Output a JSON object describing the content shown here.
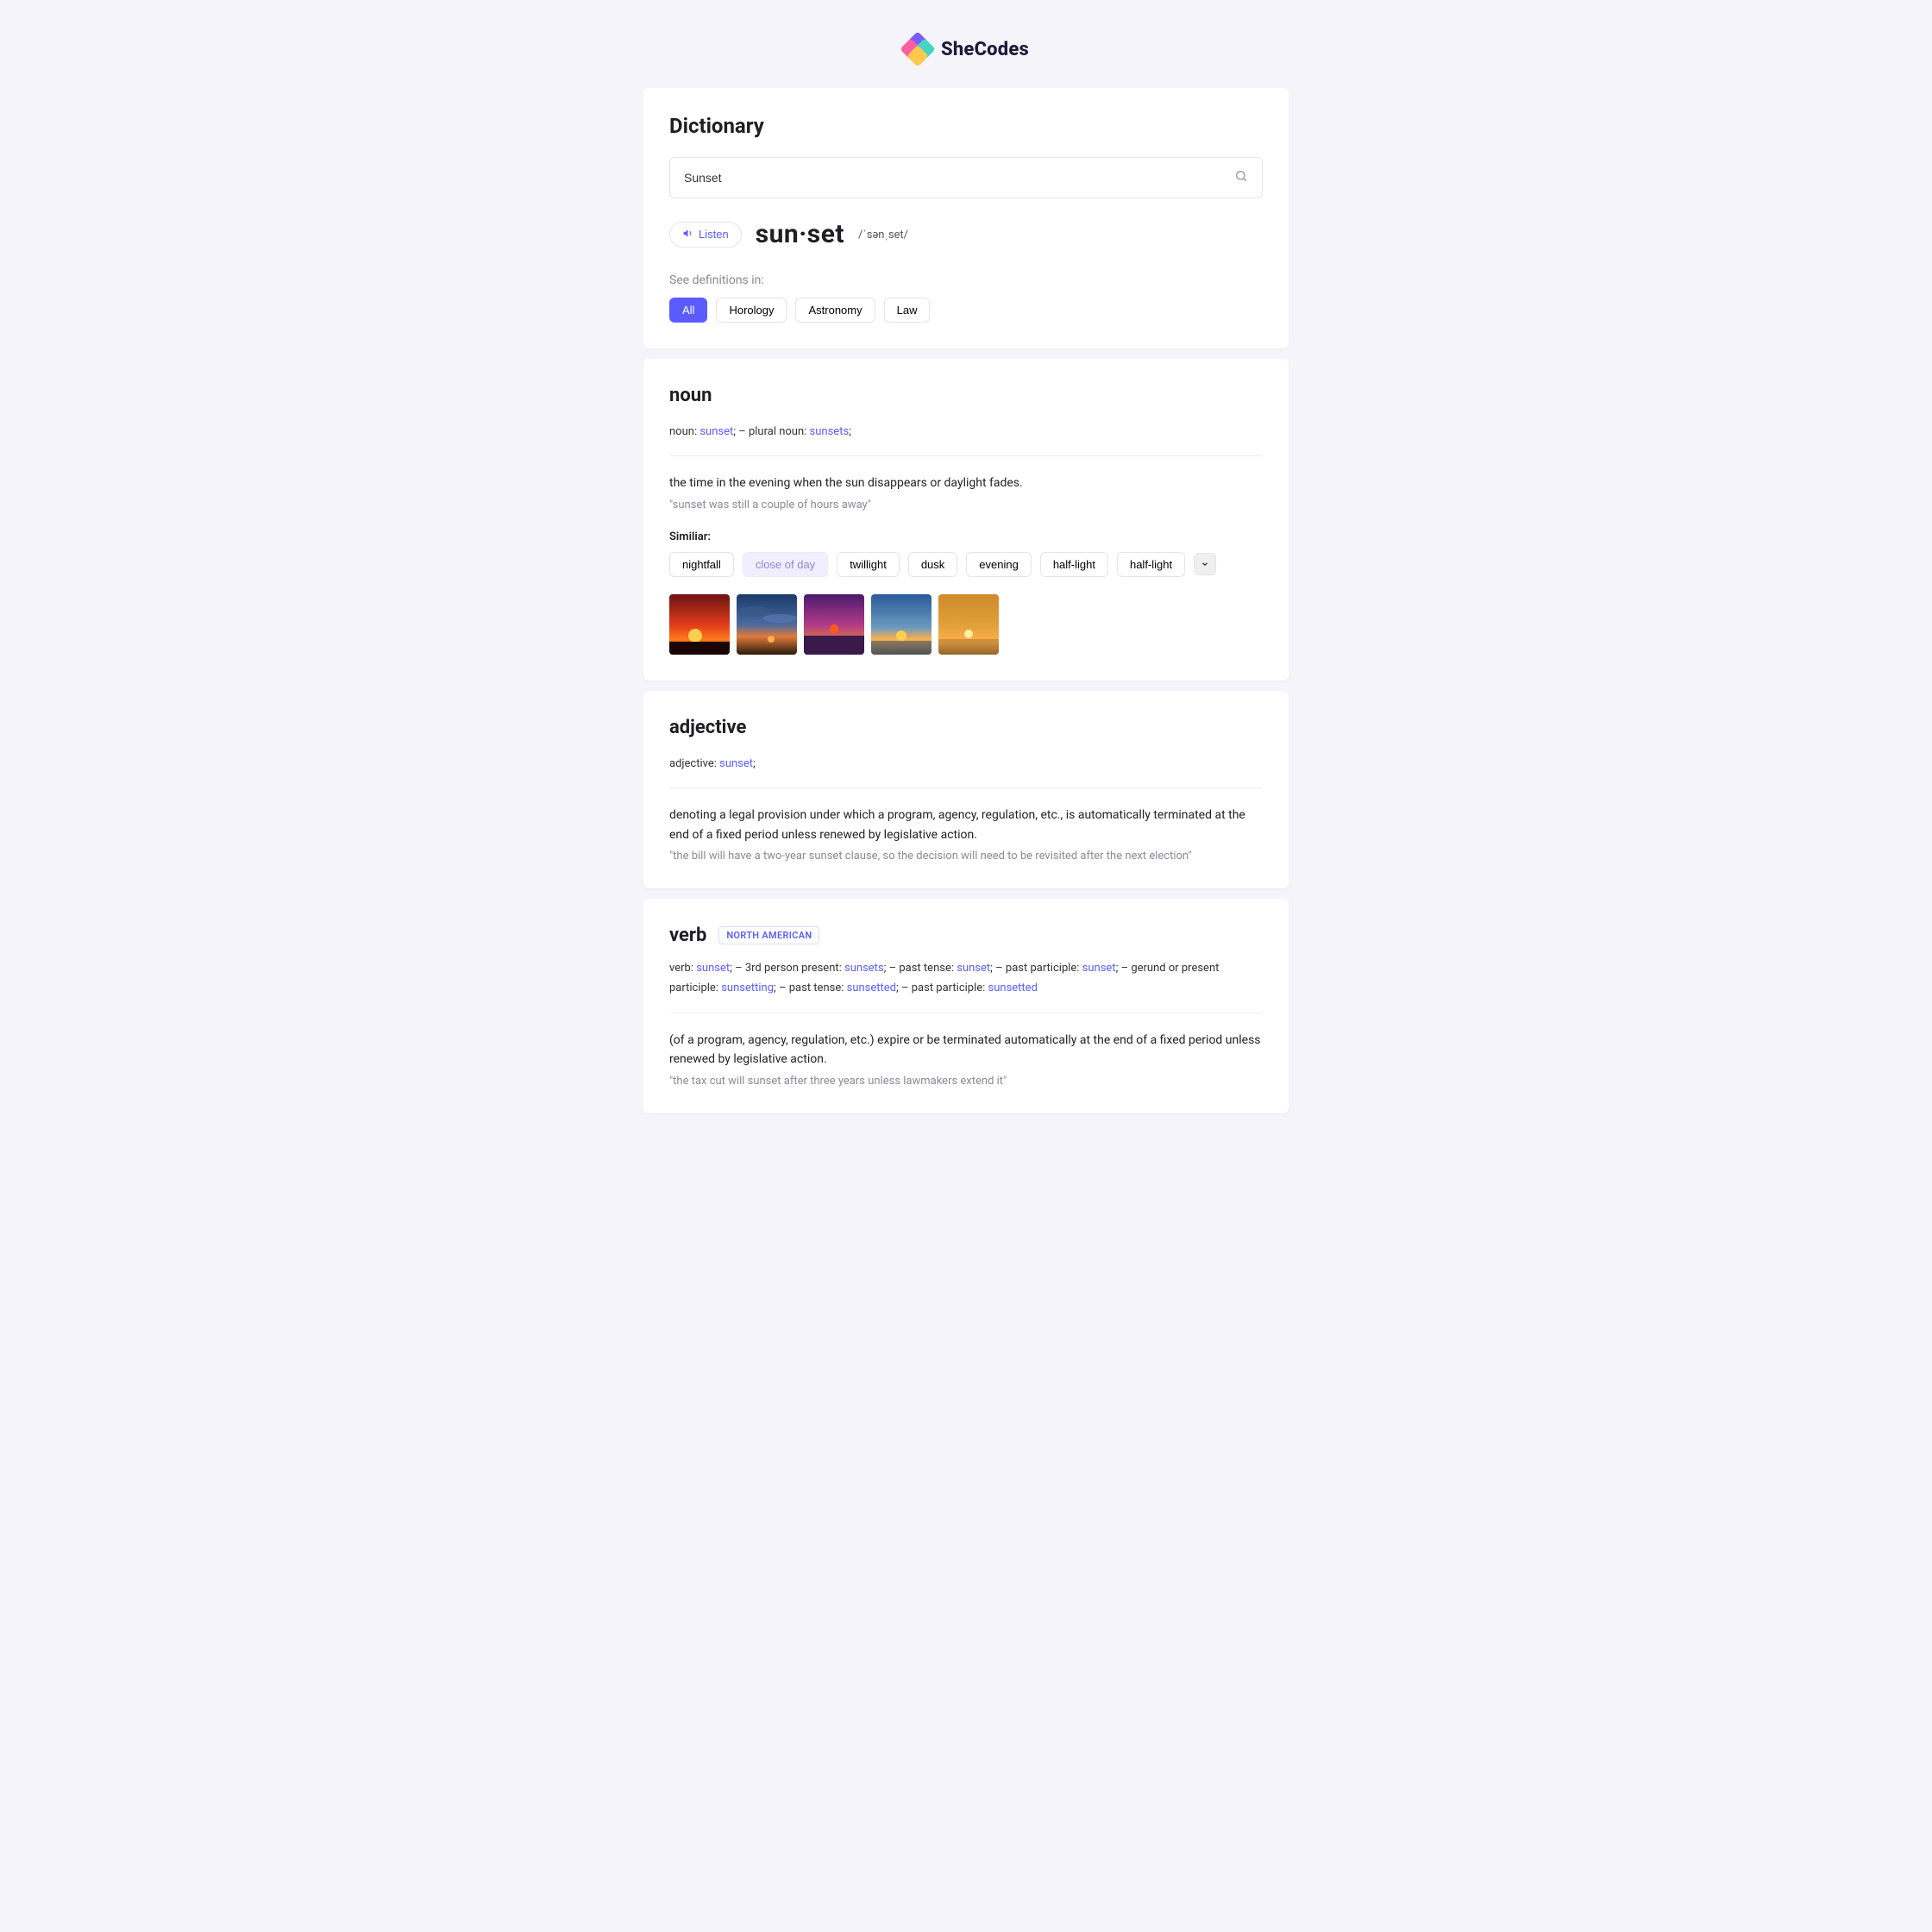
{
  "brand": "SheCodes",
  "page_title": "Dictionary",
  "search": {
    "value": "Sunset"
  },
  "listen_label": "Listen",
  "headword": "sun·set",
  "pronunciation": "/ˈsənˌset/",
  "see_definitions_label": "See definitions in:",
  "categories": [
    "All",
    "Horology",
    "Astronomy",
    "Law"
  ],
  "noun": {
    "heading": "noun",
    "forms_prefix_1": "noun: ",
    "forms_word_1": "sunset",
    "forms_sep": ";   –   ",
    "forms_prefix_2": "plural noun: ",
    "forms_word_2": "sunsets",
    "forms_tail": ";",
    "definition": "the time in the evening when the sun disappears or daylight fades.",
    "example": "\"sunset was still a couple of hours away\"",
    "similar_label": "Similiar:",
    "similar": [
      "nightfall",
      "close of day",
      "twillight",
      "dusk",
      "evening",
      "half-light",
      "half-light"
    ],
    "similar_highlight_index": 1
  },
  "adjective": {
    "heading": "adjective",
    "forms_prefix_1": "adjective: ",
    "forms_word_1": "sunset",
    "forms_tail": ";",
    "definition": "denoting a legal provision under which a program, agency, regulation, etc., is automatically terminated at the end of a fixed period unless renewed by legislative action.",
    "example": "\"the bill will have a two-year sunset clause, so the decision will need to be revisited after the next election\""
  },
  "verb": {
    "heading": "verb",
    "region": "NORTH AMERICAN",
    "forms": [
      {
        "label": "verb: ",
        "word": "sunset"
      },
      {
        "label": "3rd person present: ",
        "word": "sunsets"
      },
      {
        "label": "past tense: ",
        "word": "sunset"
      },
      {
        "label": "past participle: ",
        "word": "sunset"
      },
      {
        "label": "gerund or present participle: ",
        "word": "sunsetting"
      },
      {
        "label": "past tense: ",
        "word": "sunsetted"
      },
      {
        "label": "past participle: ",
        "word": "sunsetted"
      }
    ],
    "definition": "(of a program, agency, regulation, etc.) expire or be terminated automatically at the end of a fixed period unless renewed by legislative action.",
    "example": "\"the tax cut will sunset after three years unless lawmakers extend it\""
  }
}
